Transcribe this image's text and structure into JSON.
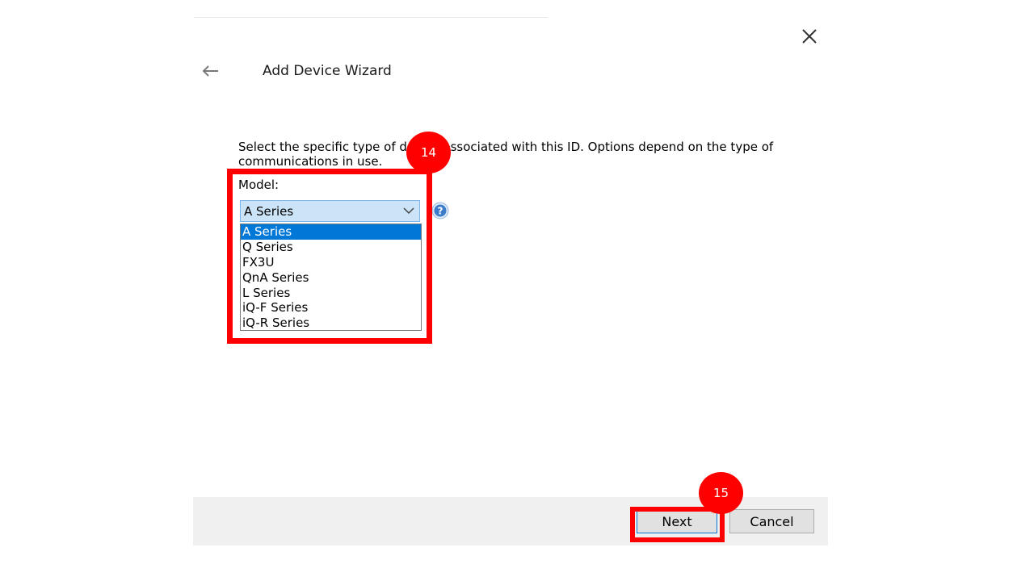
{
  "window": {
    "title": "Add Device Wizard",
    "close_icon": "close-icon",
    "back_icon": "back-arrow-icon"
  },
  "content": {
    "description_line1": "Select the specific type of device associated with this ID. Options depend on the type of",
    "description_line2": "communications in use.",
    "model_label": "Model:",
    "model_selected": "A Series",
    "help_icon": "help-icon",
    "model_options": [
      "A Series",
      "Q Series",
      "FX3U",
      "QnA Series",
      "L Series",
      "iQ-F Series",
      "iQ-R Series"
    ]
  },
  "annotations": {
    "step1": "14",
    "step2": "15",
    "highlight_color": "#ff0000"
  },
  "footer": {
    "next_label": "Next",
    "cancel_label": "Cancel"
  },
  "colors": {
    "selection": "#0078d7",
    "combo_bg": "#cce4f7",
    "footer_bg": "#f0f0f0"
  }
}
